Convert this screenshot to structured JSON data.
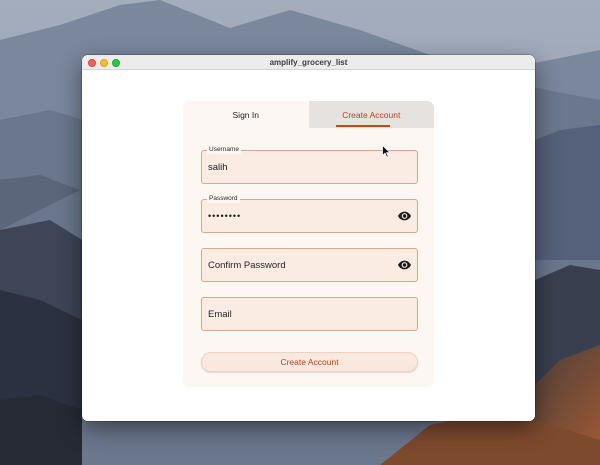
{
  "window": {
    "title": "amplify_grocery_list"
  },
  "tabs": [
    {
      "label": "Sign In",
      "active": false
    },
    {
      "label": "Create Account",
      "active": true
    }
  ],
  "form": {
    "username": {
      "label": "Username",
      "value": "salih"
    },
    "password": {
      "label": "Password",
      "value": "••••••••"
    },
    "confirm_password": {
      "placeholder": "Confirm Password"
    },
    "email": {
      "placeholder": "Email"
    },
    "submit_label": "Create Account"
  },
  "icons": {
    "password_toggle": "eye-icon",
    "confirm_toggle": "eye-icon"
  },
  "colors": {
    "accent": "#c2481a",
    "field_bg": "#faebe3",
    "card_bg": "#fdf7f4"
  }
}
